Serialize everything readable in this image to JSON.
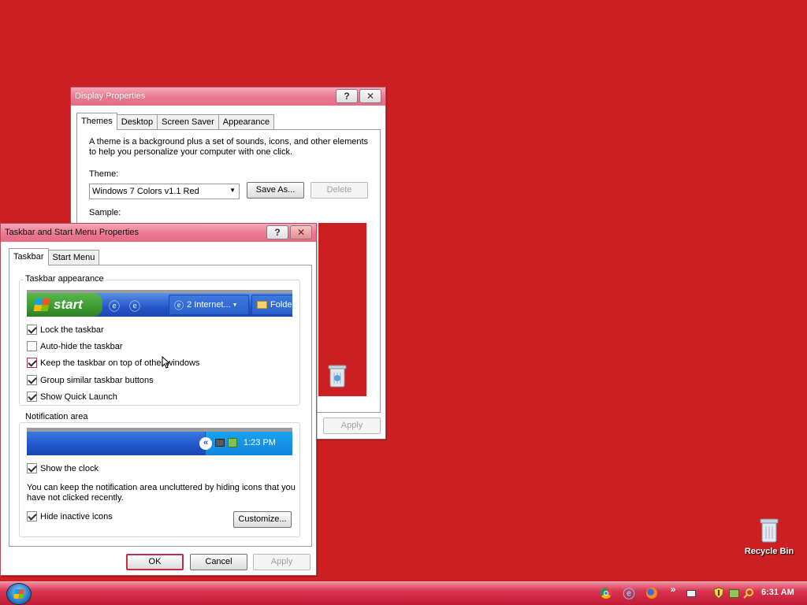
{
  "display_properties": {
    "title": "Display Properties",
    "tabs": [
      "Themes",
      "Desktop",
      "Screen Saver",
      "Appearance"
    ],
    "description": "A theme is a background plus a set of sounds, icons, and other elements to help you personalize your computer with one click.",
    "description_line1": "A theme is a background plus a set of sounds, icons, and other elements",
    "description_line2": "to help you personalize your computer with one click.",
    "theme_label": "Theme:",
    "theme_value": "Windows 7 Colors v1.1 Red",
    "save_as_label": "Save As...",
    "delete_label": "Delete",
    "sample_label": "Sample:",
    "apply_label": "Apply",
    "help_glyph": "?",
    "close_glyph": "✕"
  },
  "taskbar_properties": {
    "title": "Taskbar and Start Menu Properties",
    "tabs": [
      "Taskbar",
      "Start Menu"
    ],
    "appearance_group": "Taskbar appearance",
    "preview_start": "start",
    "preview_task1": "2 Internet...",
    "preview_task2": "Folde",
    "checkboxes": [
      {
        "label": "Lock the taskbar",
        "checked": true
      },
      {
        "label": "Auto-hide the taskbar",
        "checked": false
      },
      {
        "label": "Keep the taskbar on top of other windows",
        "checked": true
      },
      {
        "label": "Group similar taskbar buttons",
        "checked": true
      },
      {
        "label": "Show Quick Launch",
        "checked": true
      }
    ],
    "notification_group": "Notification area",
    "preview_clock": "1:23 PM",
    "show_clock_label": "Show the clock",
    "show_clock_checked": true,
    "notification_text_line1": "You can keep the notification area uncluttered by hiding icons that you",
    "notification_text_line2": "have not clicked recently.",
    "hide_inactive_label": "Hide inactive icons",
    "hide_inactive_checked": true,
    "customize_label": "Customize...",
    "ok_label": "OK",
    "cancel_label": "Cancel",
    "apply_label": "Apply",
    "help_glyph": "?",
    "close_glyph": "✕"
  },
  "desktop": {
    "recycle_bin_label": "Recycle Bin",
    "background_color": "#cc1f22"
  },
  "taskbar": {
    "clock": "6:31 AM",
    "chevron": "»",
    "tray_icons": [
      "chrome-icon",
      "internet-explorer-icon",
      "firefox-icon",
      "show-hidden-icons-chevron",
      "keyboard-icon",
      "security-shield-icon",
      "network-icon",
      "search-icon"
    ]
  }
}
